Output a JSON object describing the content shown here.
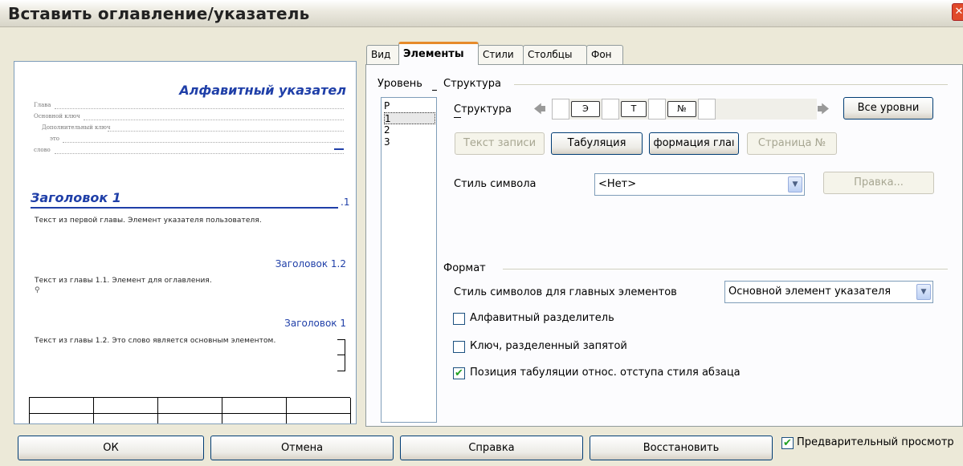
{
  "window": {
    "title": "Вставить оглавление/указатель",
    "close_glyph": "✕"
  },
  "tabs": [
    {
      "label": "Вид"
    },
    {
      "label": "Элементы"
    },
    {
      "label": "Стили"
    },
    {
      "label": "Столбцы"
    },
    {
      "label": "Фон"
    }
  ],
  "levels": {
    "label": "Уровень",
    "items": [
      "Р",
      "1",
      "2",
      "3"
    ],
    "selected": "1"
  },
  "structure_group": {
    "title": "Структура",
    "label": "Структура",
    "tokens": [
      "Э",
      "Т",
      "№"
    ],
    "all_levels_button": "Все уровни",
    "buttons": {
      "entry_text": "Текст записи",
      "tab": "Табуляция",
      "chapter_info": "формация глаı",
      "page_no": "Страница №"
    },
    "char_style_label": "Стиль символа",
    "char_style_value": "<Нет>",
    "edit_button": "Правка..."
  },
  "format_group": {
    "title": "Формат",
    "main_entry_style_label": "Стиль символов для главных элементов",
    "main_entry_style_value": "Основной элемент указателя",
    "alpha_delimiter": {
      "label": "Алфавитный разделитель",
      "checked": false
    },
    "keys_separate": {
      "label": "Ключ, разделенный запятой",
      "checked": false
    },
    "tab_relative": {
      "label": "Позиция табуляции относ. отступа стиля абзаца",
      "checked": true
    }
  },
  "preview": {
    "index_title": "Алфавитный указател",
    "small_lines": [
      "Глава",
      "Основной ключ",
      "Дополнительный ключ",
      "это",
      "слово"
    ],
    "heading1": "Заголовок 1",
    "heading1_num": ".1",
    "text1": "Текст из первой главы. Элемент указателя пользователя.",
    "heading12": "Заголовок 1.2",
    "text2": "Текст из главы 1.1. Элемент для оглавления.",
    "heading1b": "Заголовок 1",
    "text3": "Текст из главы 1.2. Это слово является основным элементом."
  },
  "footer": {
    "ok": "ОК",
    "cancel": "Отмена",
    "help": "Справка",
    "reset": "Восстановить",
    "preview_label": "Предварительный просмотр",
    "preview_checked": true
  }
}
